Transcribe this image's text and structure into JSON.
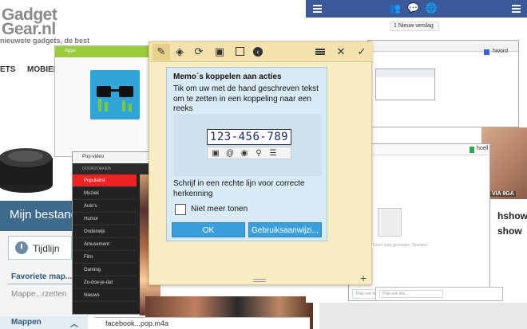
{
  "site": {
    "logo_line1": "Gadget",
    "logo_line2": "Gear.nl",
    "tagline": "nieuwste gadgets, de best",
    "nav": [
      "ETS",
      "MOBIEL"
    ]
  },
  "file_manager": {
    "title": "Mijn bestand",
    "tab_label": "Tijdlijn",
    "section_favorites": "Favoriete map...",
    "placeholder_item": "Mappe...rzetten",
    "folders_label": "Mappen"
  },
  "app_window": {
    "bar_label": "Apps"
  },
  "youtube": {
    "header": "Pop-video",
    "subheader": "DOORZOEKEN",
    "items": [
      "Populairst",
      "Muziek",
      "Auto's",
      "Humor",
      "Onderwijs",
      "Amusement",
      "Film",
      "Gaming",
      "Zo-doe-je-dat",
      "Nieuws"
    ]
  },
  "facebook": {
    "story_label": "1 Nieuw verslag",
    "caption": "VIA 9GA",
    "show_1": "hshow",
    "show_2": "show"
  },
  "windows": {
    "hword": "hword",
    "hcell": "hcell",
    "hcell_sub": "Geen map gevonden. Bestand...",
    "hcell_input": "Plak een link..."
  },
  "bottom_file": "facebook...pop.m4a",
  "popup": {
    "title": "Memo´s koppelen aan acties",
    "body": "Tik om uw met de hand geschreven tekst om te zetten in een koppeling naar een reeks",
    "demo_number": "123-456-789",
    "hint": "Schrijf in een rechte lijn voor correcte herkenning",
    "checkbox_label": "Niet meer tonen",
    "ok_label": "OK",
    "guide_label": "Gebruiksaanwijzi..."
  },
  "colors": {
    "note_bg": "#f8ecc2",
    "popup_bg": "#d8ebf7",
    "button_blue": "#3a9fdc",
    "facebook_blue": "#3b5998"
  }
}
